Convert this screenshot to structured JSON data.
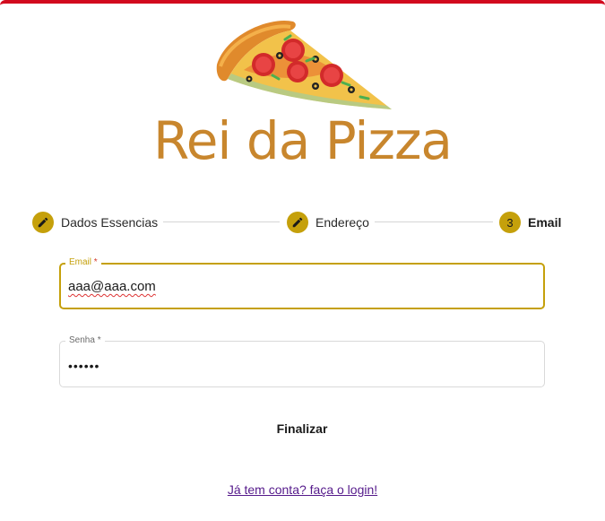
{
  "brand": {
    "name": "Rei da Pizza",
    "accent": "#c8862d"
  },
  "logo": {
    "icon": "pizza-slice-icon"
  },
  "stepper": {
    "steps": [
      {
        "label": "Dados Essencias",
        "marker": "",
        "icon": "pencil-icon"
      },
      {
        "label": "Endereço",
        "marker": "",
        "icon": "pencil-icon"
      },
      {
        "label": "Email",
        "marker": "3"
      }
    ],
    "accent": "#c5a00b"
  },
  "form": {
    "email": {
      "label": "Email",
      "required_mark": "*",
      "value": "aaa@aaa.com"
    },
    "password": {
      "label": "Senha",
      "required_mark": "*",
      "value": "••••••"
    },
    "submit_label": "Finalizar"
  },
  "footer": {
    "login_link": "Já tem conta? faça o login!"
  }
}
